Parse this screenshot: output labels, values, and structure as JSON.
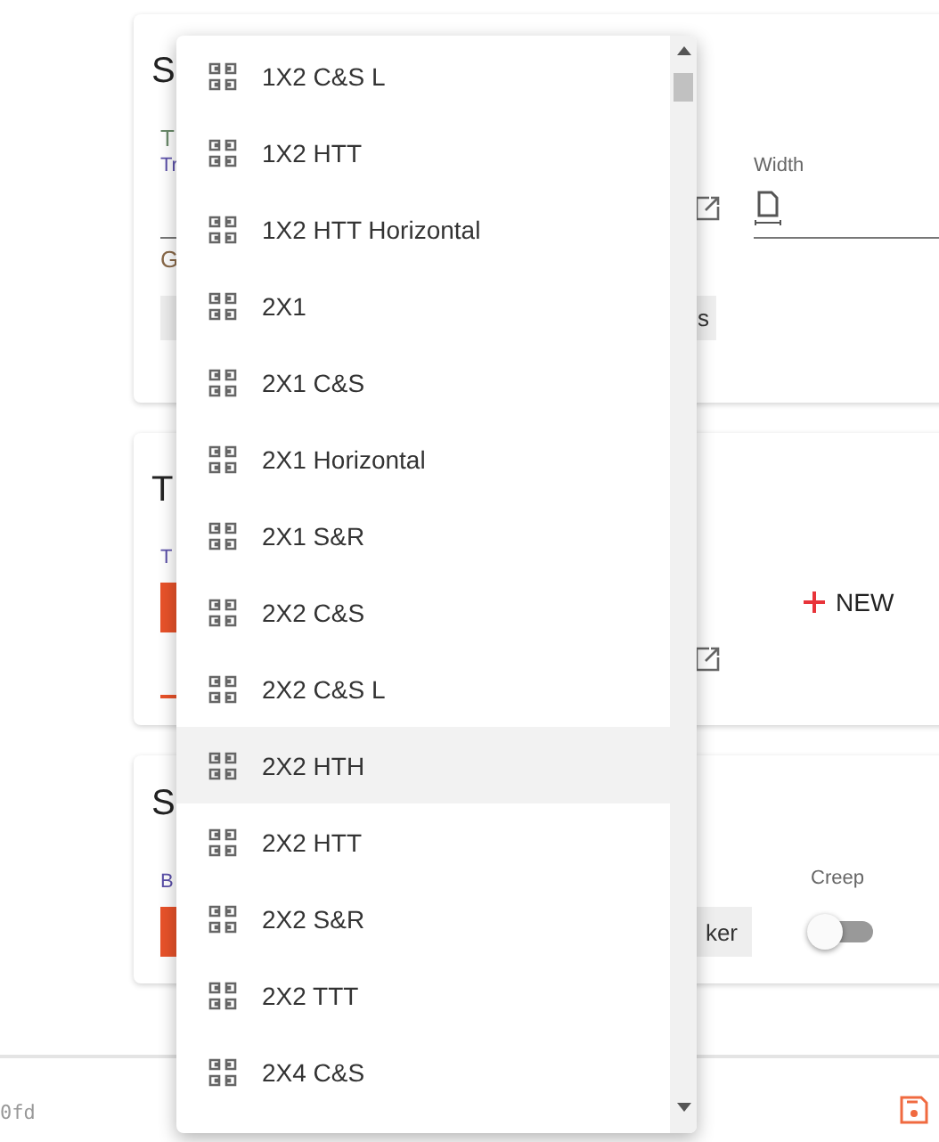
{
  "cards": [
    {
      "kind": "settings",
      "title": "S",
      "subtitle": "T",
      "field_label": "Tr",
      "lower_label": "G",
      "chip": "s",
      "width_label": "Width"
    },
    {
      "kind": "list",
      "title": "T",
      "field_label": "T",
      "new_button": "NEW"
    },
    {
      "kind": "switches",
      "title": "S",
      "field_label": "B",
      "chip": "ker",
      "switch": {
        "label": "Creep",
        "on": false
      }
    }
  ],
  "footer": {
    "text": "0fd"
  },
  "menu": {
    "items": [
      {
        "label": "1X2 C&S L",
        "selected": false
      },
      {
        "label": "1X2 HTT",
        "selected": false
      },
      {
        "label": "1X2 HTT Horizontal",
        "selected": false
      },
      {
        "label": "2X1",
        "selected": false
      },
      {
        "label": "2X1 C&S",
        "selected": false
      },
      {
        "label": "2X1 Horizontal",
        "selected": false
      },
      {
        "label": "2X1 S&R",
        "selected": false
      },
      {
        "label": "2X2 C&S",
        "selected": false
      },
      {
        "label": "2X2 C&S L",
        "selected": false
      },
      {
        "label": "2X2 HTH",
        "selected": true
      },
      {
        "label": "2X2 HTT",
        "selected": false
      },
      {
        "label": "2X2 S&R",
        "selected": false
      },
      {
        "label": "2X2 TTT",
        "selected": false
      },
      {
        "label": "2X4 C&S",
        "selected": false
      }
    ]
  }
}
